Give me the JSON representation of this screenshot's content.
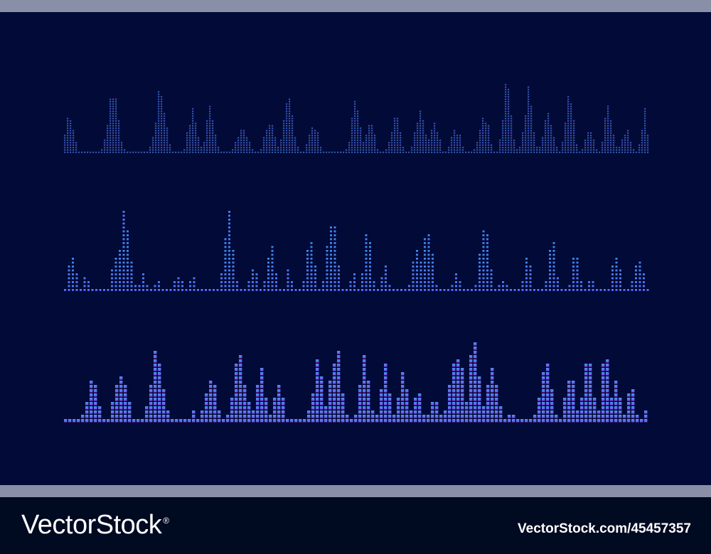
{
  "footer": {
    "brand": "VectorStock",
    "brand_mark": "®",
    "image_id": "VectorStock.com/45457357"
  },
  "colors": {
    "background": "#020a38",
    "cyan": "#3fa9f5",
    "blue": "#4a6cf0",
    "purple": "#7a3cf0",
    "magenta": "#b03ae0",
    "footer_bg": "#000a21"
  },
  "waveforms": [
    {
      "name": "thin-dotted-waveform",
      "style": "fine-dots",
      "direction": "up"
    },
    {
      "name": "peak-dotted-waveform",
      "style": "peak-dots",
      "direction": "up"
    },
    {
      "name": "block-equalizer-waveform",
      "style": "square-blocks",
      "direction": "up"
    }
  ]
}
